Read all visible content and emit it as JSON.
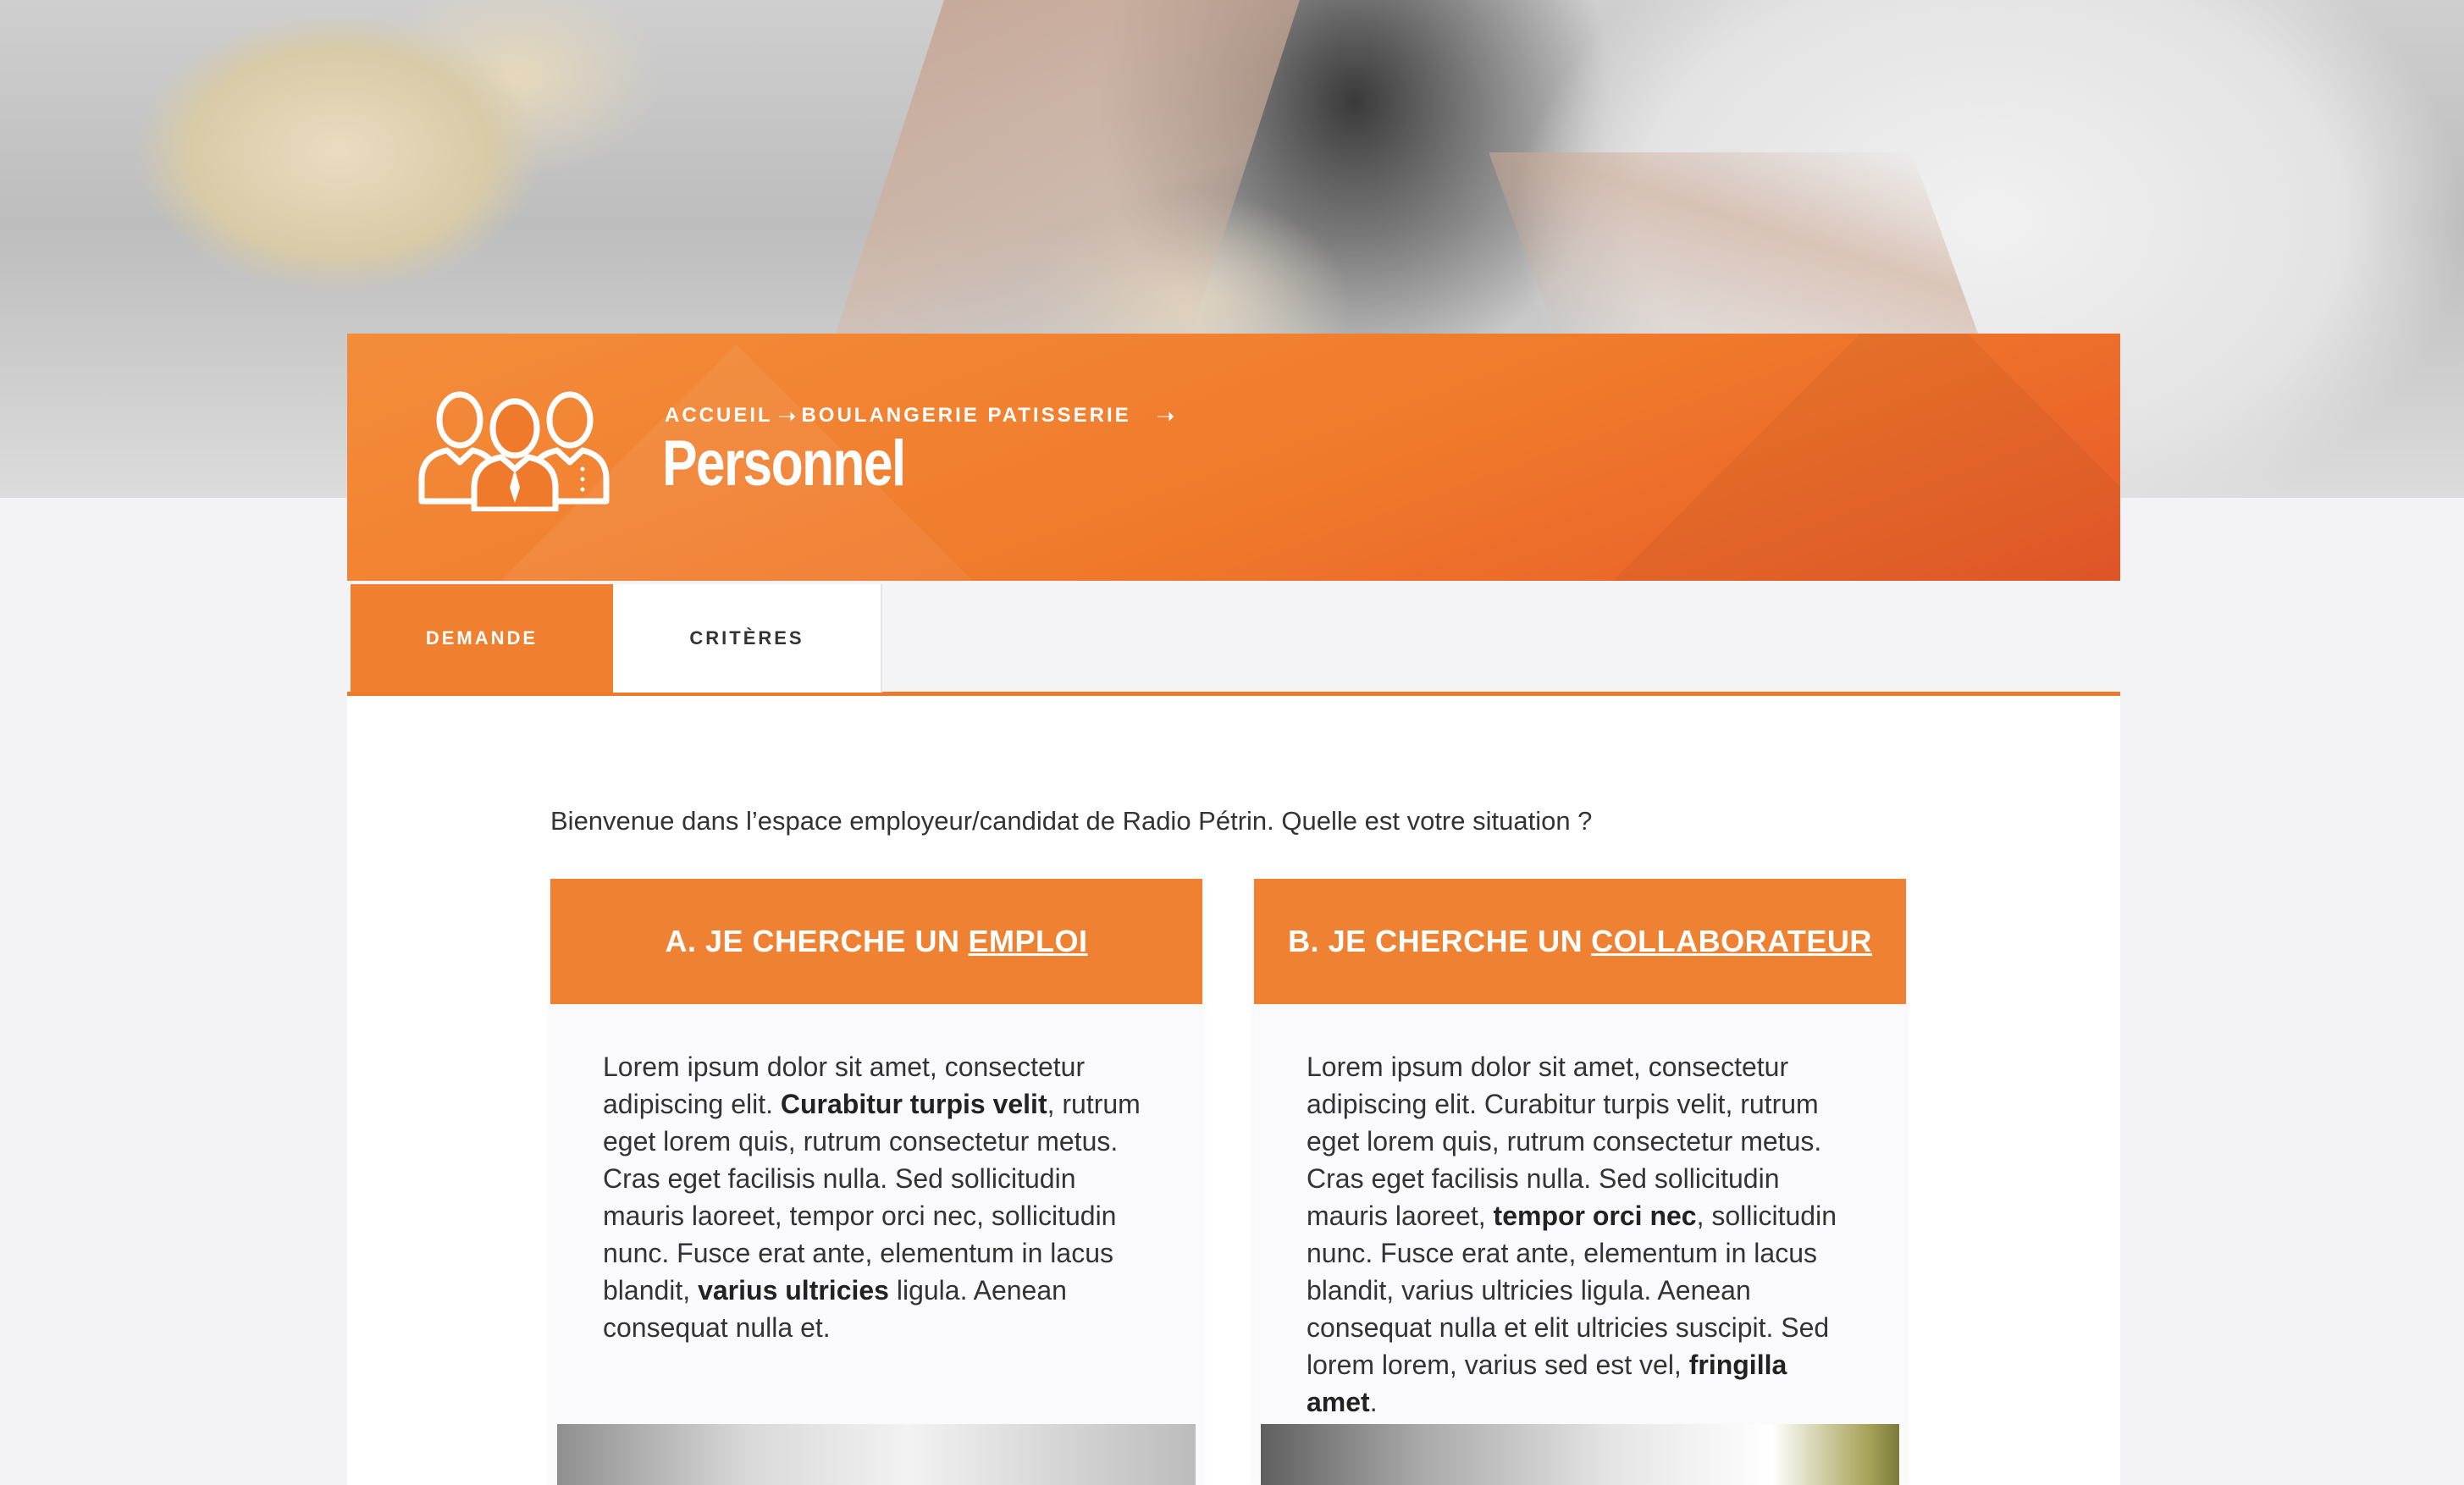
{
  "breadcrumb": {
    "home": "ACCUEIL",
    "section": "BOULANGERIE PATISSERIE",
    "separator": "➝"
  },
  "page_title": "Personnel",
  "tabs": [
    {
      "label": "DEMANDE",
      "active": true
    },
    {
      "label": "CRITÈRES",
      "active": false
    }
  ],
  "intro": "Bienvenue dans l’espace employeur/candidat de Radio Pétrin. Quelle est votre situation  ?",
  "cards": {
    "a": {
      "title_prefix": "A. JE CHERCHE UN",
      "title_link": "EMPLOI",
      "text": [
        {
          "t": "Lorem ipsum dolor sit amet, consectetur adipiscing elit. ",
          "b": false
        },
        {
          "t": "Curabitur turpis velit",
          "b": true
        },
        {
          "t": ", rutrum eget lorem quis, rutrum consectetur metus. Cras eget facilisis nulla. Sed sollicitudin mauris laoreet, tempor orci nec, sollicitudin nunc. Fusce erat ante, elementum in lacus blandit, ",
          "b": false
        },
        {
          "t": "varius ultricies",
          "b": true
        },
        {
          "t": " ligula. Aenean consequat nulla et.",
          "b": false
        }
      ]
    },
    "b": {
      "title_prefix": "B. JE CHERCHE UN",
      "title_link": "COLLABORATEUR",
      "text": [
        {
          "t": "Lorem ipsum dolor sit amet, consectetur adipiscing elit. Curabitur turpis velit, rutrum eget lorem quis, rutrum consectetur metus. Cras eget facilisis nulla. Sed sollicitudin mauris laoreet, ",
          "b": false
        },
        {
          "t": "tempor orci nec",
          "b": true
        },
        {
          "t": ", sollicitudin nunc. Fusce erat ante, elementum in lacus blandit, varius ultricies ligula. Aenean consequat nulla et elit ultricies suscipit. Sed lorem lorem, varius sed est vel, ",
          "b": false
        },
        {
          "t": "fringilla amet",
          "b": true
        },
        {
          "t": ".",
          "b": false
        }
      ]
    }
  },
  "colors": {
    "accent": "#f07a2b",
    "accent_dark": "#e8592a",
    "text": "#333333",
    "background": "#f3f3f5"
  },
  "icons": {
    "logo": "personnel-group-icon",
    "breadcrumb_arrow": "arrow-right-icon"
  }
}
